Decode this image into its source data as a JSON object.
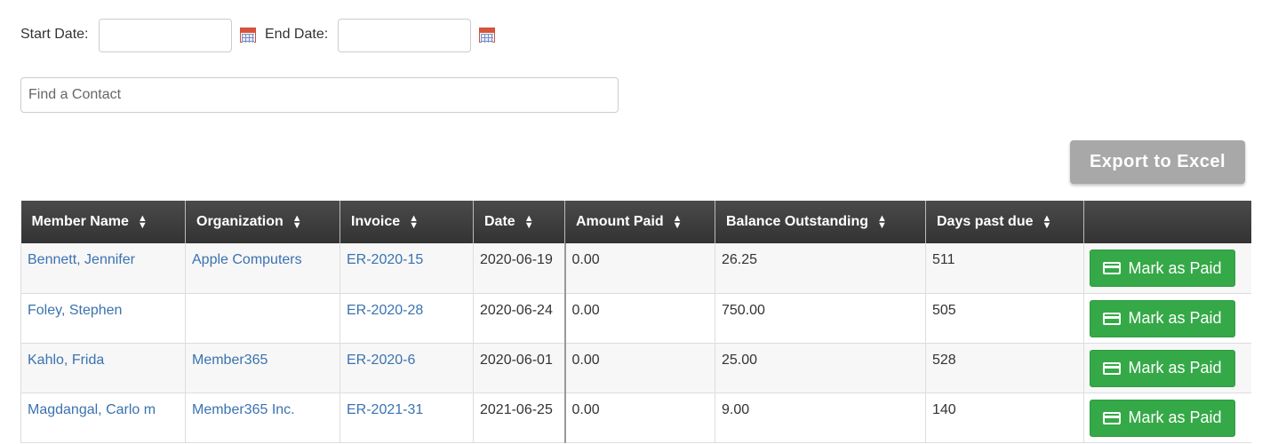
{
  "filters": {
    "start_label": "Start Date:",
    "end_label": "End Date:",
    "start_value": "",
    "end_value": ""
  },
  "search": {
    "placeholder": "Find a Contact"
  },
  "export_label": "Export to Excel",
  "table": {
    "columns": [
      "Member Name",
      "Organization",
      "Invoice",
      "Date",
      "Amount Paid",
      "Balance Outstanding",
      "Days past due",
      ""
    ],
    "rows": [
      {
        "member": "Bennett, Jennifer",
        "org": "Apple Computers",
        "invoice": "ER-2020-15",
        "date": "2020-06-19",
        "paid": "0.00",
        "balance": "26.25",
        "days": "511"
      },
      {
        "member": "Foley, Stephen",
        "org": "",
        "invoice": "ER-2020-28",
        "date": "2020-06-24",
        "paid": "0.00",
        "balance": "750.00",
        "days": "505"
      },
      {
        "member": "Kahlo, Frida",
        "org": "Member365",
        "invoice": "ER-2020-6",
        "date": "2020-06-01",
        "paid": "0.00",
        "balance": "25.00",
        "days": "528"
      },
      {
        "member": "Magdangal, Carlo m",
        "org": "Member365 Inc.",
        "invoice": "ER-2021-31",
        "date": "2021-06-25",
        "paid": "0.00",
        "balance": "9.00",
        "days": "140"
      }
    ],
    "action_label": "Mark as Paid"
  },
  "colors": {
    "link": "#3a72b0",
    "mark_paid_button": "#35a947",
    "export_button": "#a8a8a8",
    "header_bg": "#3a3a3a"
  },
  "icons": {
    "calendar": "calendar-icon",
    "sort": "sort-icon",
    "card": "credit-card-icon"
  }
}
